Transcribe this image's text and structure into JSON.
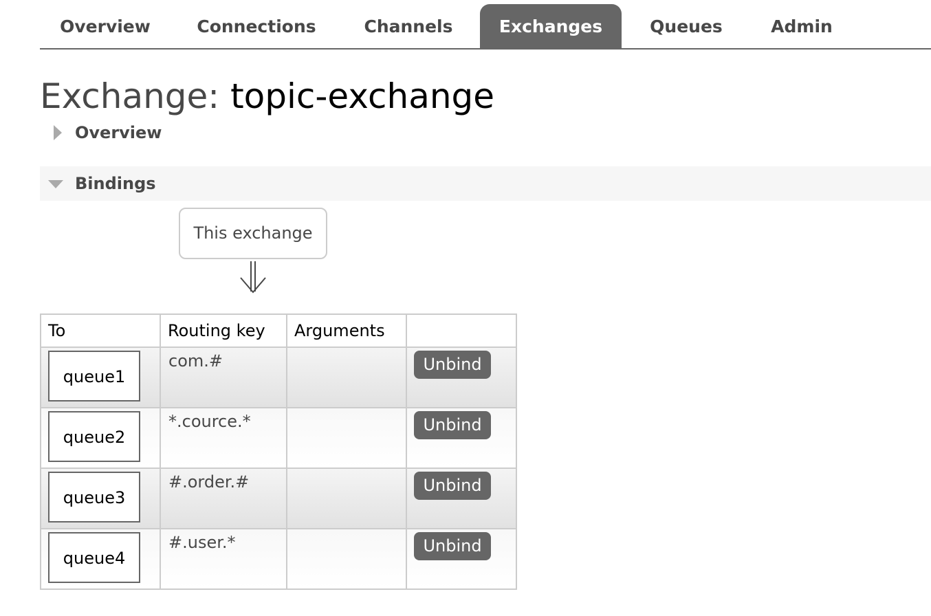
{
  "nav": {
    "items": [
      {
        "label": "Overview",
        "active": false
      },
      {
        "label": "Connections",
        "active": false
      },
      {
        "label": "Channels",
        "active": false
      },
      {
        "label": "Exchanges",
        "active": true
      },
      {
        "label": "Queues",
        "active": false
      },
      {
        "label": "Admin",
        "active": false
      }
    ]
  },
  "page": {
    "title_prefix": "Exchange:",
    "title_name": "topic-exchange"
  },
  "sections": {
    "overview": {
      "label": "Overview",
      "expanded": false
    },
    "bindings": {
      "label": "Bindings",
      "expanded": true
    }
  },
  "bindings": {
    "source_label": "This exchange",
    "arrow_icon": "double-down-arrow",
    "columns": [
      "To",
      "Routing key",
      "Arguments",
      ""
    ],
    "rows": [
      {
        "to": "queue1",
        "routing_key": "com.#",
        "arguments": "",
        "action": "Unbind"
      },
      {
        "to": "queue2",
        "routing_key": "*.cource.*",
        "arguments": "",
        "action": "Unbind"
      },
      {
        "to": "queue3",
        "routing_key": "#.order.#",
        "arguments": "",
        "action": "Unbind"
      },
      {
        "to": "queue4",
        "routing_key": "#.user.*",
        "arguments": "",
        "action": "Unbind"
      }
    ]
  },
  "colors": {
    "accent": "#666666",
    "text": "#484848",
    "border": "#cccccc"
  }
}
